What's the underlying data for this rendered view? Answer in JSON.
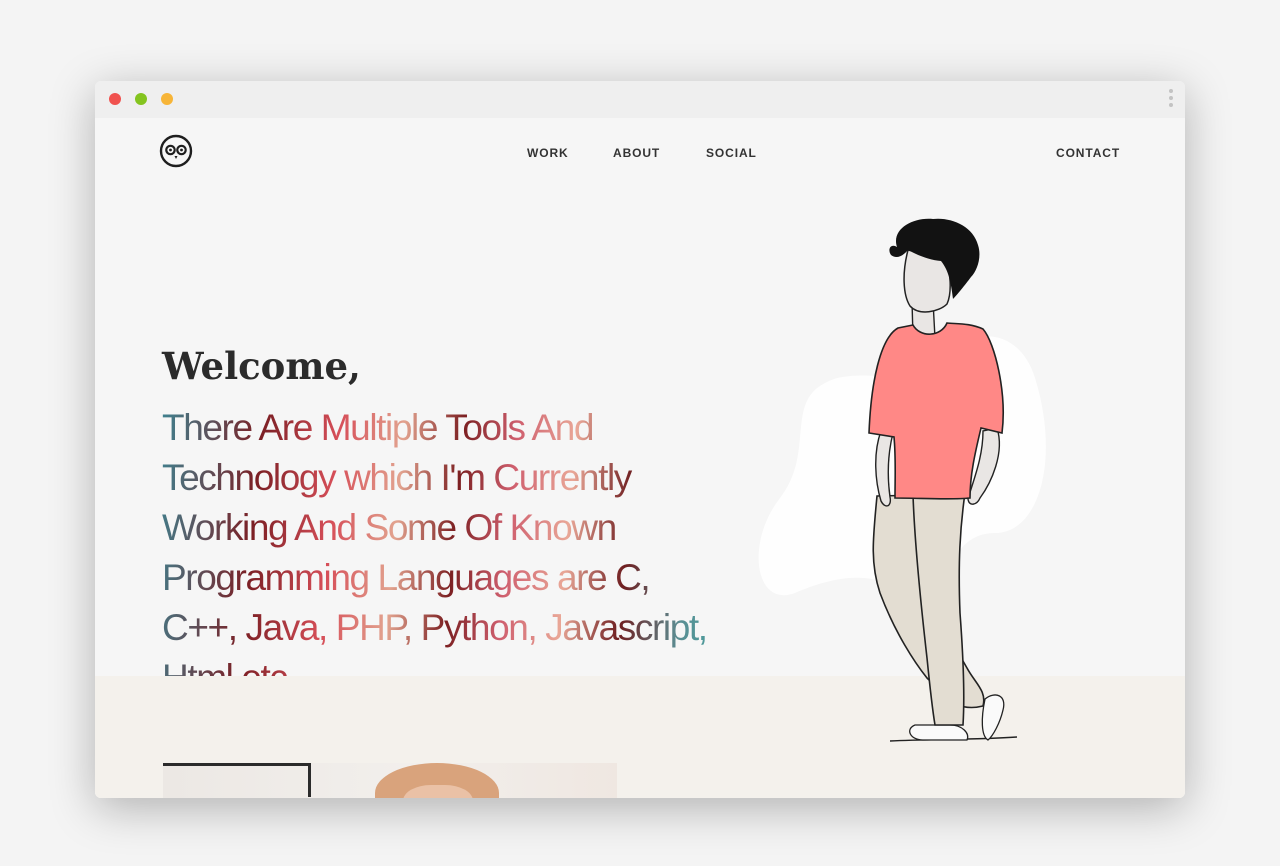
{
  "nav": {
    "logo_icon": "owl-icon",
    "links": [
      "WORK",
      "ABOUT",
      "SOCIAL"
    ],
    "contact": "CONTACT"
  },
  "hero": {
    "greeting": "Welcome,",
    "text": "There Are Multiple Tools And Technology which I'm Currently Working And Some Of Known Programming Languages are C, C++, Java, PHP, Python, Javascript, Html etc."
  },
  "colors": {
    "shirt": "#ff8886",
    "pants": "#e3ddd2",
    "hair": "#121212",
    "close_dot": "#f0524f",
    "maximize_dot": "#84c41f",
    "minimize_dot": "#f7b538"
  }
}
